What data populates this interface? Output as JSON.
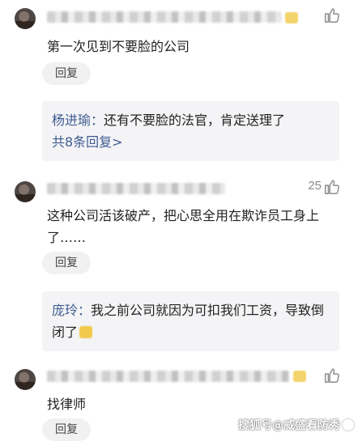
{
  "comments": [
    {
      "text": "第一次见到不要脸的公司",
      "reply_label": "回复",
      "sub": {
        "author": "杨进瑜：",
        "text": "还有不要脸的法官，肯定送理了",
        "more": "共8条回复>"
      }
    },
    {
      "likes": "25",
      "text": "这种公司活该破产，把心思全用在欺诈员工身上了……",
      "reply_label": "回复",
      "sub": {
        "author": "庞玲：",
        "text": "我之前公司就因为可扣我们工资，导致倒闭了"
      }
    },
    {
      "text": "找律师",
      "reply_label": "回复"
    }
  ],
  "watermark": "搜狐号@威盛看防秀",
  "icons": [
    "avatar",
    "thumbs-up-icon",
    "emoji-icon",
    "watermark-logo-icon"
  ]
}
